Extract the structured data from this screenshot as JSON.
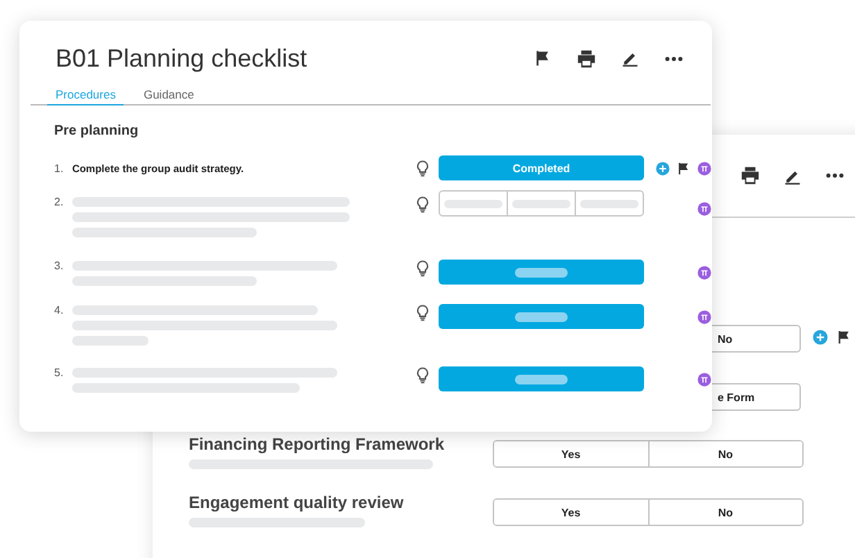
{
  "back_card": {
    "rows": [
      {
        "options": [
          "No"
        ],
        "added": true,
        "flagged": true
      },
      {
        "options": [
          "e Form"
        ],
        "added": false,
        "flagged": false
      },
      {
        "title": "Financing Reporting Framework",
        "options": [
          "Yes",
          "No"
        ],
        "added": false,
        "flagged": false
      },
      {
        "title": "Engagement quality review",
        "options": [
          "Yes",
          "No"
        ],
        "added": false,
        "flagged": false
      }
    ]
  },
  "checklist": {
    "title": "B01 Planning checklist",
    "tabs": [
      {
        "label": "Procedures",
        "selected": true
      },
      {
        "label": "Guidance",
        "selected": false
      }
    ],
    "section": "Pre planning",
    "items": [
      {
        "number": "1.",
        "text": "Complete the group audit strategy.",
        "kind": "status",
        "status": "Completed",
        "added": true,
        "flagged": true
      },
      {
        "number": "2.",
        "kind": "segmented",
        "added": false,
        "flagged": false
      },
      {
        "number": "3.",
        "kind": "filled",
        "added": false,
        "flagged": false
      },
      {
        "number": "4.",
        "kind": "filled",
        "added": false,
        "flagged": false
      },
      {
        "number": "5.",
        "kind": "filled",
        "added": false,
        "flagged": false
      }
    ]
  }
}
